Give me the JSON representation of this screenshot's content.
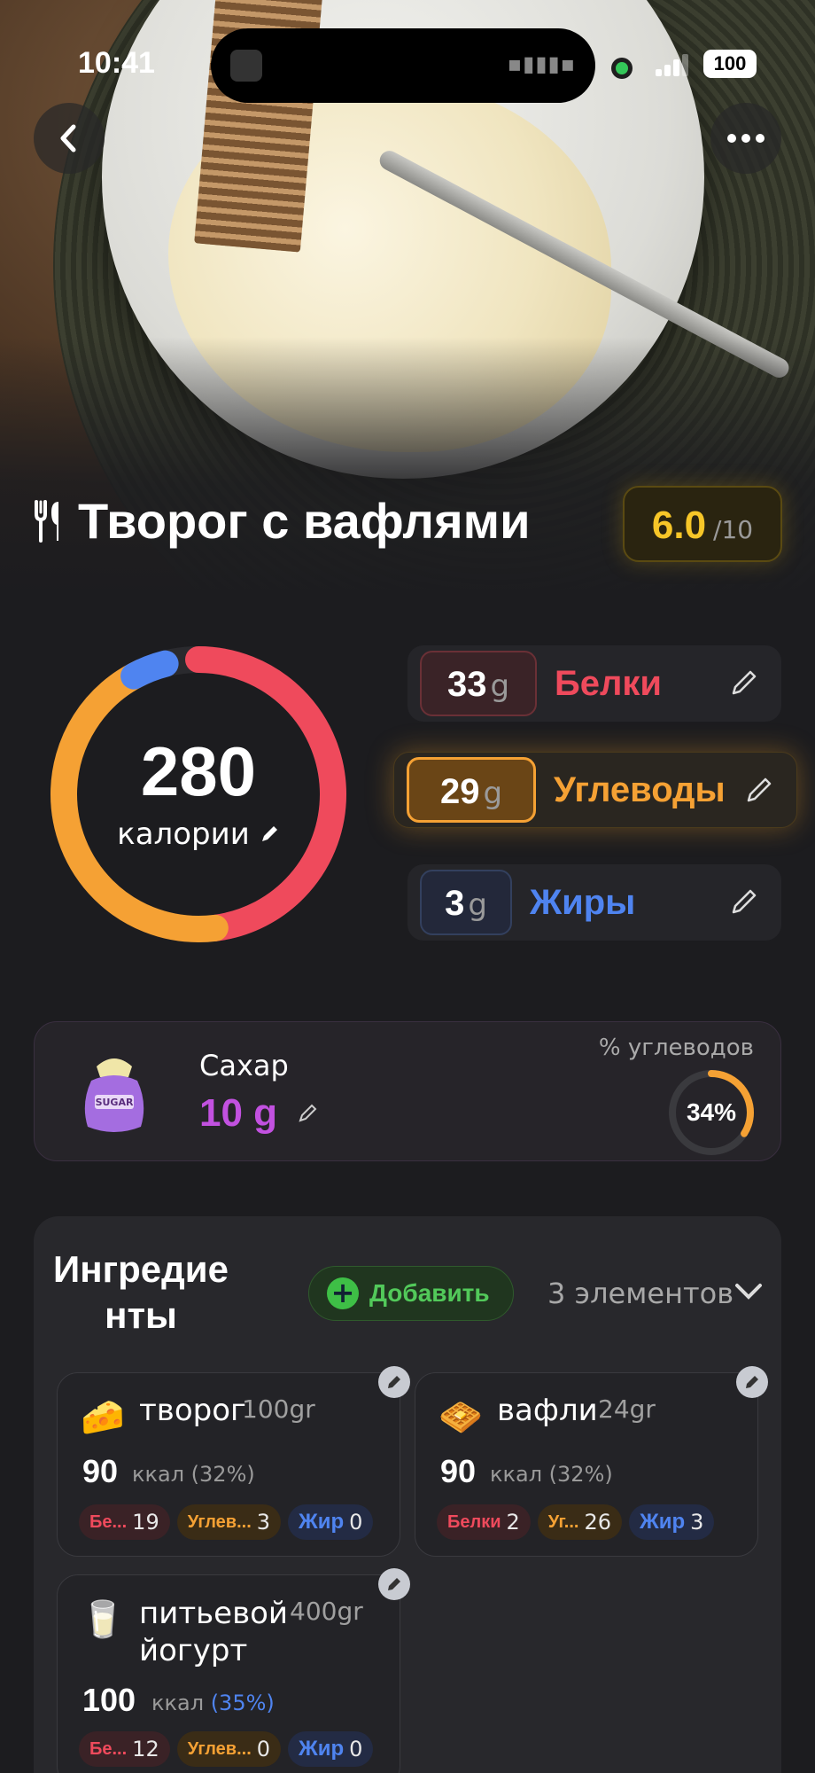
{
  "status": {
    "time": "10:41",
    "battery": "100"
  },
  "dish": {
    "title": "Творог с вафлями",
    "score": "6.0",
    "score_max": "/10"
  },
  "calories": {
    "value": "280",
    "label": "калории",
    "ring": {
      "orange_frac": 0.45,
      "red_frac": 0.48,
      "blue_frac": 0.04
    }
  },
  "macros": {
    "protein": {
      "value": "33",
      "unit": "g",
      "label": "Белки"
    },
    "carbs": {
      "value": "29",
      "unit": "g",
      "label": "Углеводы"
    },
    "fat": {
      "value": "3",
      "unit": "g",
      "label": "Жиры"
    }
  },
  "sugar": {
    "label": "Сахар",
    "value": "10 g",
    "pct_label": "% углеводов",
    "pct": "34%",
    "pct_value": 0.34
  },
  "ingredients": {
    "title": "Ингредиенты",
    "add_label": "Добавить",
    "count_label": "3 элементов",
    "items": [
      {
        "emoji": "🧀",
        "name": "творог",
        "weight": "100gr",
        "kcal": "90",
        "kcal_unit": "ккал (32%)",
        "chips": [
          {
            "label": "Бе...",
            "value": "19"
          },
          {
            "label": "Углев...",
            "value": "3"
          },
          {
            "label": "Жир",
            "value": "0"
          }
        ]
      },
      {
        "emoji": "🧇",
        "name": "вафли",
        "weight": "24gr",
        "kcal": "90",
        "kcal_unit": "ккал (32%)",
        "chips": [
          {
            "label": "Белки",
            "value": "2"
          },
          {
            "label": "Уг...",
            "value": "26"
          },
          {
            "label": "Жир",
            "value": "3"
          }
        ]
      },
      {
        "emoji": "🥛",
        "name": "питьевой йогурт",
        "name_line1": "питьевой",
        "name_line2": "йогурт",
        "weight": "400gr",
        "kcal": "100",
        "kcal_unit": "ккал",
        "kcal_pct": "(35%)",
        "chips": [
          {
            "label": "Бе...",
            "value": "12"
          },
          {
            "label": "Углев...",
            "value": "0"
          },
          {
            "label": "Жир",
            "value": "0"
          }
        ]
      }
    ]
  },
  "colors": {
    "protein": "#ef4a5c",
    "carbs": "#f5a134",
    "fat": "#4f84f0",
    "sugar": "#c251e0",
    "score": "#f7c628",
    "add": "#52c95a"
  }
}
